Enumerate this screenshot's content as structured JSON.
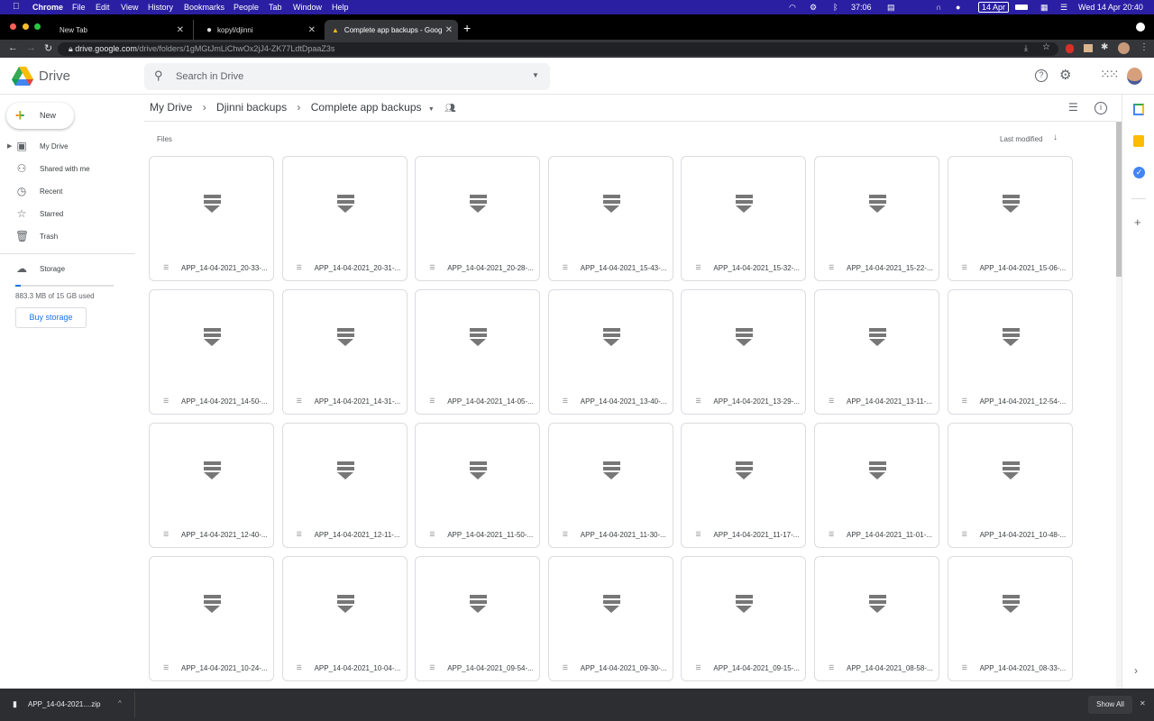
{
  "menubar": {
    "app": "Chrome",
    "items": [
      "File",
      "Edit",
      "View",
      "History",
      "Bookmarks",
      "People",
      "Tab",
      "Window",
      "Help"
    ],
    "timer": "37:06",
    "date_badge": "14 Apr",
    "clock": "Wed 14 Apr  20:40"
  },
  "tabs": [
    {
      "title": "New Tab"
    },
    {
      "title": "kopyl/djinni"
    },
    {
      "title": "Complete app backups - Goog"
    }
  ],
  "address": {
    "host": "drive.google.com",
    "path": "/drive/folders/1gMGtJmLiChwOx2jJ4-ZK77LdtDpaaZ3s"
  },
  "drive": {
    "logo_text": "Drive",
    "search_placeholder": "Search in Drive"
  },
  "sidebar": {
    "new_label": "New",
    "items": [
      {
        "label": "My Drive",
        "icon": "my-drive-icon"
      },
      {
        "label": "Shared with me",
        "icon": "people-icon"
      },
      {
        "label": "Recent",
        "icon": "clock-icon"
      },
      {
        "label": "Starred",
        "icon": "star-icon"
      },
      {
        "label": "Trash",
        "icon": "trash-icon"
      }
    ],
    "storage_label": "Storage",
    "storage_used": "883.3 MB of 15 GB used",
    "storage_fraction": 0.057,
    "buy_storage": "Buy storage"
  },
  "breadcrumb": [
    "My Drive",
    "Djinni backups",
    "Complete app backups"
  ],
  "files_label": "Files",
  "sort_label": "Last modified",
  "files": [
    "APP_14-04-2021_20-33-...",
    "APP_14-04-2021_20-31-...",
    "APP_14-04-2021_20-28-...",
    "APP_14-04-2021_15-43-...",
    "APP_14-04-2021_15-32-...",
    "APP_14-04-2021_15-22-...",
    "APP_14-04-2021_15-06-...",
    "APP_14-04-2021_14-50-...",
    "APP_14-04-2021_14-31-...",
    "APP_14-04-2021_14-05-...",
    "APP_14-04-2021_13-40-...",
    "APP_14-04-2021_13-29-...",
    "APP_14-04-2021_13-11-...",
    "APP_14-04-2021_12-54-...",
    "APP_14-04-2021_12-40-...",
    "APP_14-04-2021_12-11-...",
    "APP_14-04-2021_11-50-...",
    "APP_14-04-2021_11-30-...",
    "APP_14-04-2021_11-17-...",
    "APP_14-04-2021_11-01-...",
    "APP_14-04-2021_10-48-...",
    "APP_14-04-2021_10-24-...",
    "APP_14-04-2021_10-04-...",
    "APP_14-04-2021_09-54-...",
    "APP_14-04-2021_09-30-...",
    "APP_14-04-2021_09-15-...",
    "APP_14-04-2021_08-58-...",
    "APP_14-04-2021_08-33-..."
  ],
  "download": {
    "file": "APP_14-04-2021....zip",
    "show_all": "Show All"
  }
}
